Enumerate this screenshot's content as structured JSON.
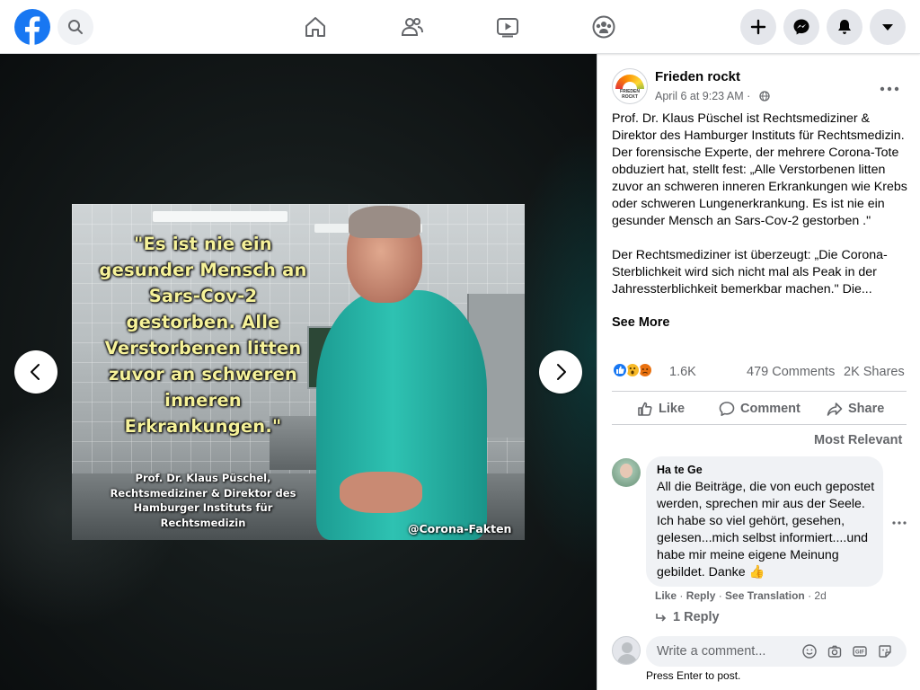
{
  "topbar": {
    "logo": "facebook-logo",
    "nav_icons": [
      "home-icon",
      "friends-icon",
      "watch-icon",
      "groups-icon"
    ],
    "right_buttons": [
      "plus-icon",
      "messenger-icon",
      "bell-icon",
      "caret-down-icon"
    ]
  },
  "photo": {
    "quote": "\"Es ist nie ein gesunder Mensch an Sars-Cov-2 gestorben. Alle Verstorbenen litten zuvor an schweren inneren Erkrankungen.\"",
    "caption": "Prof. Dr. Klaus Püschel, Rechtsmediziner & Direktor des Hamburger Instituts für Rechtsmedizin",
    "handle": "@Corona-Fakten"
  },
  "post": {
    "page_name": "Frieden rockt",
    "avatar_label": "FRIEDEN ROCKT",
    "timestamp": "April 6 at 9:23 AM",
    "separator": "·",
    "text": "Prof. Dr. Klaus Püschel ist Rechtsmediziner & Direktor des Hamburger Instituts für Rechtsmedizin. Der forensische Experte, der mehrere Corona-Tote obduziert hat, stellt fest: „Alle Verstorbenen litten zuvor an schweren inneren Erkrankungen wie Krebs oder schweren Lungenerkrankung. Es ist nie ein gesunder Mensch an Sars-Cov-2 gestorben .\"\n\nDer Rechtsmediziner ist überzeugt: „Die Corona-Sterblichkeit wird sich nicht mal als Peak in der Jahressterblichkeit bemerkbar machen.\" Die...",
    "see_more": "See More",
    "reaction_count": "1.6K",
    "comments_count": "479 Comments",
    "shares_count": "2K Shares",
    "actions": {
      "like": "Like",
      "comment": "Comment",
      "share": "Share"
    },
    "sort_label": "Most Relevant"
  },
  "comment": {
    "author": "Ha te Ge",
    "text": "All die Beiträge, die von euch gepostet werden, sprechen mir aus der Seele. Ich habe so viel gehört, gesehen, gelesen...mich selbst informiert....und habe mir meine eigene Meinung gebildet. Danke 👍",
    "like": "Like",
    "reply": "Reply",
    "see_translation": "See Translation",
    "age": "2d",
    "dot": " · ",
    "replies": "1 Reply"
  },
  "composer": {
    "placeholder": "Write a comment...",
    "hint": "Press Enter to post."
  },
  "colors": {
    "brand": "#1877f2",
    "secondary_text": "#65676b",
    "like_blue": "#1877f2",
    "haha_yellow": "#f7b928",
    "angry_orange": "#e9710f"
  }
}
